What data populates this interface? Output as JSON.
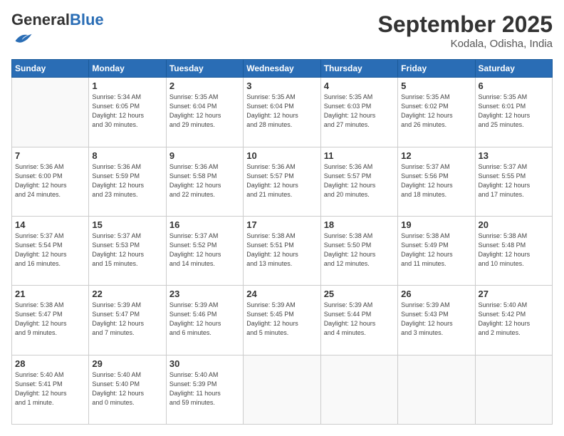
{
  "header": {
    "logo_general": "General",
    "logo_blue": "Blue",
    "month_title": "September 2025",
    "location": "Kodala, Odisha, India"
  },
  "weekdays": [
    "Sunday",
    "Monday",
    "Tuesday",
    "Wednesday",
    "Thursday",
    "Friday",
    "Saturday"
  ],
  "weeks": [
    [
      {
        "day": "",
        "info": ""
      },
      {
        "day": "1",
        "info": "Sunrise: 5:34 AM\nSunset: 6:05 PM\nDaylight: 12 hours\nand 30 minutes."
      },
      {
        "day": "2",
        "info": "Sunrise: 5:35 AM\nSunset: 6:04 PM\nDaylight: 12 hours\nand 29 minutes."
      },
      {
        "day": "3",
        "info": "Sunrise: 5:35 AM\nSunset: 6:04 PM\nDaylight: 12 hours\nand 28 minutes."
      },
      {
        "day": "4",
        "info": "Sunrise: 5:35 AM\nSunset: 6:03 PM\nDaylight: 12 hours\nand 27 minutes."
      },
      {
        "day": "5",
        "info": "Sunrise: 5:35 AM\nSunset: 6:02 PM\nDaylight: 12 hours\nand 26 minutes."
      },
      {
        "day": "6",
        "info": "Sunrise: 5:35 AM\nSunset: 6:01 PM\nDaylight: 12 hours\nand 25 minutes."
      }
    ],
    [
      {
        "day": "7",
        "info": "Sunrise: 5:36 AM\nSunset: 6:00 PM\nDaylight: 12 hours\nand 24 minutes."
      },
      {
        "day": "8",
        "info": "Sunrise: 5:36 AM\nSunset: 5:59 PM\nDaylight: 12 hours\nand 23 minutes."
      },
      {
        "day": "9",
        "info": "Sunrise: 5:36 AM\nSunset: 5:58 PM\nDaylight: 12 hours\nand 22 minutes."
      },
      {
        "day": "10",
        "info": "Sunrise: 5:36 AM\nSunset: 5:57 PM\nDaylight: 12 hours\nand 21 minutes."
      },
      {
        "day": "11",
        "info": "Sunrise: 5:36 AM\nSunset: 5:57 PM\nDaylight: 12 hours\nand 20 minutes."
      },
      {
        "day": "12",
        "info": "Sunrise: 5:37 AM\nSunset: 5:56 PM\nDaylight: 12 hours\nand 18 minutes."
      },
      {
        "day": "13",
        "info": "Sunrise: 5:37 AM\nSunset: 5:55 PM\nDaylight: 12 hours\nand 17 minutes."
      }
    ],
    [
      {
        "day": "14",
        "info": "Sunrise: 5:37 AM\nSunset: 5:54 PM\nDaylight: 12 hours\nand 16 minutes."
      },
      {
        "day": "15",
        "info": "Sunrise: 5:37 AM\nSunset: 5:53 PM\nDaylight: 12 hours\nand 15 minutes."
      },
      {
        "day": "16",
        "info": "Sunrise: 5:37 AM\nSunset: 5:52 PM\nDaylight: 12 hours\nand 14 minutes."
      },
      {
        "day": "17",
        "info": "Sunrise: 5:38 AM\nSunset: 5:51 PM\nDaylight: 12 hours\nand 13 minutes."
      },
      {
        "day": "18",
        "info": "Sunrise: 5:38 AM\nSunset: 5:50 PM\nDaylight: 12 hours\nand 12 minutes."
      },
      {
        "day": "19",
        "info": "Sunrise: 5:38 AM\nSunset: 5:49 PM\nDaylight: 12 hours\nand 11 minutes."
      },
      {
        "day": "20",
        "info": "Sunrise: 5:38 AM\nSunset: 5:48 PM\nDaylight: 12 hours\nand 10 minutes."
      }
    ],
    [
      {
        "day": "21",
        "info": "Sunrise: 5:38 AM\nSunset: 5:47 PM\nDaylight: 12 hours\nand 9 minutes."
      },
      {
        "day": "22",
        "info": "Sunrise: 5:39 AM\nSunset: 5:47 PM\nDaylight: 12 hours\nand 7 minutes."
      },
      {
        "day": "23",
        "info": "Sunrise: 5:39 AM\nSunset: 5:46 PM\nDaylight: 12 hours\nand 6 minutes."
      },
      {
        "day": "24",
        "info": "Sunrise: 5:39 AM\nSunset: 5:45 PM\nDaylight: 12 hours\nand 5 minutes."
      },
      {
        "day": "25",
        "info": "Sunrise: 5:39 AM\nSunset: 5:44 PM\nDaylight: 12 hours\nand 4 minutes."
      },
      {
        "day": "26",
        "info": "Sunrise: 5:39 AM\nSunset: 5:43 PM\nDaylight: 12 hours\nand 3 minutes."
      },
      {
        "day": "27",
        "info": "Sunrise: 5:40 AM\nSunset: 5:42 PM\nDaylight: 12 hours\nand 2 minutes."
      }
    ],
    [
      {
        "day": "28",
        "info": "Sunrise: 5:40 AM\nSunset: 5:41 PM\nDaylight: 12 hours\nand 1 minute."
      },
      {
        "day": "29",
        "info": "Sunrise: 5:40 AM\nSunset: 5:40 PM\nDaylight: 12 hours\nand 0 minutes."
      },
      {
        "day": "30",
        "info": "Sunrise: 5:40 AM\nSunset: 5:39 PM\nDaylight: 11 hours\nand 59 minutes."
      },
      {
        "day": "",
        "info": ""
      },
      {
        "day": "",
        "info": ""
      },
      {
        "day": "",
        "info": ""
      },
      {
        "day": "",
        "info": ""
      }
    ]
  ]
}
